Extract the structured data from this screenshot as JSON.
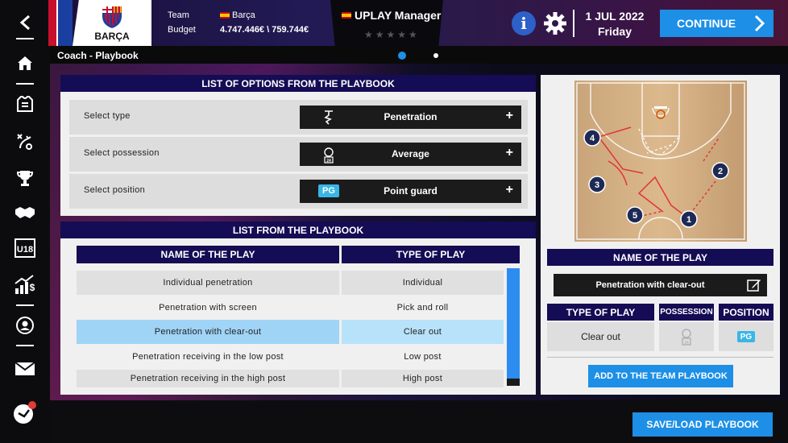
{
  "topbar": {
    "team_label": "Team",
    "team_value": "Barça",
    "budget_label": "Budget",
    "budget_value": "4.747.446€ \\ 759.744€",
    "club_name": "BARÇA",
    "manager_name": "UPLAY Manager",
    "stars": "★★★★★",
    "date": "1 JUL 2022",
    "weekday": "Friday",
    "continue_label": "CONTINUE"
  },
  "breadcrumb": "Coach - Playbook",
  "options_panel": {
    "title": "LIST OF OPTIONS FROM THE PLAYBOOK",
    "rows": [
      {
        "label": "Select type",
        "value": "Penetration",
        "icon": "penetration-icon"
      },
      {
        "label": "Select possession",
        "value": "Average",
        "icon": "possession-timer-icon"
      },
      {
        "label": "Select position",
        "value": "Point guard",
        "badge": "PG"
      }
    ]
  },
  "list_panel": {
    "title": "LIST FROM THE PLAYBOOK",
    "col_name": "NAME OF THE PLAY",
    "col_type": "TYPE OF PLAY",
    "rows": [
      {
        "name": "Individual penetration",
        "type": "Individual"
      },
      {
        "name": "Penetration with screen",
        "type": "Pick and roll"
      },
      {
        "name": "Penetration with clear-out",
        "type": "Clear out"
      },
      {
        "name": "Penetration receiving in the low post",
        "type": "Low post"
      },
      {
        "name": "Penetration receiving in the high post",
        "type": "High post"
      }
    ]
  },
  "detail_panel": {
    "name_header": "NAME OF THE PLAY",
    "play_name": "Penetration with clear-out",
    "type_header": "TYPE OF PLAY",
    "possession_header": "POSSESSION",
    "position_header": "POSITION",
    "type_value": "Clear out",
    "position_badge": "PG",
    "players": [
      "1",
      "2",
      "3",
      "4",
      "5"
    ],
    "add_button": "ADD TO THE TEAM PLAYBOOK"
  },
  "save_button": "SAVE/LOAD PLAYBOOK",
  "colors": {
    "accent": "#1d8fe6",
    "header": "#140c54",
    "selected_row": "#9fd4f7",
    "badge": "#3ab6e6"
  }
}
